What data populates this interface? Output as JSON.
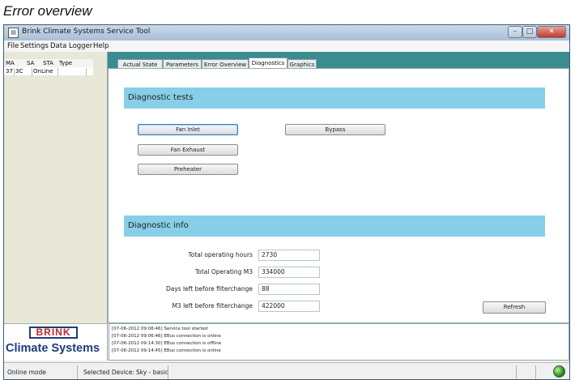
{
  "caption": "Error overview",
  "window": {
    "title": "Brink Climate Systems Service Tool"
  },
  "menu": [
    "File",
    "Settings",
    "Data Logger",
    "Help"
  ],
  "devices": {
    "columns": [
      "MA",
      "SA",
      "STA",
      "Type"
    ],
    "rows": [
      {
        "ma": "37",
        "sa": "3C",
        "sta": "OnLine",
        "type": ""
      }
    ]
  },
  "tabs": [
    "Actual State",
    "Parameters",
    "Error Overview",
    "Diagnostics",
    "Graphics"
  ],
  "active_tab": "Diagnostics",
  "diagnostic_tests": {
    "title": "Diagnostic tests",
    "buttons": [
      "Fan Inlet",
      "Fan Exhaust",
      "Preheater",
      "Bypass"
    ]
  },
  "diagnostic_info": {
    "title": "Diagnostic info",
    "fields": [
      {
        "label": "Total operating hours",
        "value": "2730"
      },
      {
        "label": "Total Operating M3",
        "value": "334000"
      },
      {
        "label": "Days left before filterchange",
        "value": "88"
      },
      {
        "label": "M3 left before filterchange",
        "value": "422000"
      }
    ],
    "refresh_label": "Refresh"
  },
  "log": [
    "[07-06-2012 09:06:46]  Service tool started",
    "[07-06-2012 09:06:46]  EBus connection is online",
    "[07-06-2012 09:14:30]  EBus connection is offline",
    "[07-06-2012 09:14:45]  EBus connection is online"
  ],
  "logo": {
    "brand": "BRINK",
    "tagline": "Climate Systems"
  },
  "status": {
    "mode": "Online mode",
    "selected_device_label": "Selected Device:",
    "selected_device_value": "Sky - basic",
    "connection_color": "#2a9a1c"
  }
}
